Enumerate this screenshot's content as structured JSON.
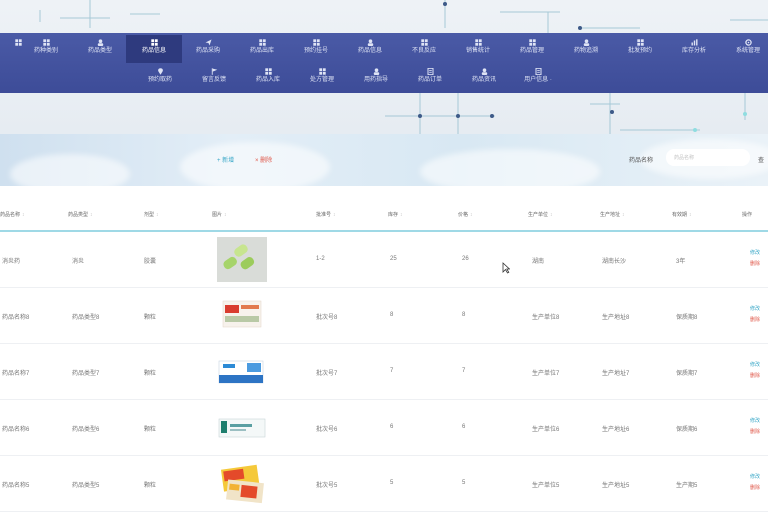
{
  "colors": {
    "nav_bg": "#3f4e9b",
    "nav_active": "#2e3a7e",
    "accent_teal": "#3aa8c8",
    "danger_red": "#e0584a",
    "header_line": "#9fd9e6"
  },
  "nav": {
    "row1": [
      {
        "label": "",
        "icon": "grid-icon"
      },
      {
        "label": "药种类别",
        "icon": "grid-icon"
      },
      {
        "label": "药品类型",
        "icon": "user-icon"
      },
      {
        "label": "药品信息",
        "icon": "grid-icon",
        "active": true
      },
      {
        "label": "药品采购",
        "icon": "send-icon"
      },
      {
        "label": "药品出库",
        "icon": "grid-icon"
      },
      {
        "label": "预约挂号",
        "icon": "grid-icon"
      },
      {
        "label": "药品信息",
        "icon": "user-icon"
      },
      {
        "label": "不良反应",
        "icon": "grid-icon"
      },
      {
        "label": "销售统计",
        "icon": "grid-icon"
      },
      {
        "label": "药品管理",
        "icon": "grid-icon"
      },
      {
        "label": "药物追溯",
        "icon": "user-icon"
      },
      {
        "label": "批发预约",
        "icon": "grid-icon"
      },
      {
        "label": "库存分析",
        "icon": "chart-icon"
      },
      {
        "label": "系统管理",
        "icon": "gear-icon"
      }
    ],
    "row2": [
      {
        "label": "预约取药",
        "icon": "pin-icon"
      },
      {
        "label": "留言反馈",
        "icon": "flag-icon"
      },
      {
        "label": "药品入库",
        "icon": "grid-icon"
      },
      {
        "label": "处方管理",
        "icon": "grid-icon"
      },
      {
        "label": "用药指导",
        "icon": "user-icon"
      },
      {
        "label": "药品订单",
        "icon": "doc-icon"
      },
      {
        "label": "药品资讯",
        "icon": "user-icon"
      },
      {
        "label": "用户信息 ·",
        "icon": "doc-icon"
      }
    ]
  },
  "toolbar": {
    "add_label": "+ 新增",
    "delete_label": "× 删除",
    "search_label": "药品名称",
    "search_placeholder": "药品名称",
    "cut_text": "查"
  },
  "table": {
    "columns": [
      "药品名称",
      "药品类型",
      "剂型",
      "图片",
      "批准号",
      "库存",
      "价格",
      "生产单位",
      "生产地址",
      "有效期",
      "操作"
    ],
    "rows": [
      {
        "name": "消炎药",
        "type": "消炎",
        "form": "胶囊",
        "img": "pack-green",
        "approval": "1-2",
        "stock": "25",
        "price": "26",
        "maker": "湖南",
        "address": "湖南长沙",
        "expiry": "3年"
      },
      {
        "name": "药品名称8",
        "type": "药品类型8",
        "form": "颗粒",
        "img": "pack-red",
        "approval": "批次号8",
        "stock": "8",
        "price": "8",
        "maker": "生产单位8",
        "address": "生产地址8",
        "expiry": "保质期8"
      },
      {
        "name": "药品名称7",
        "type": "药品类型7",
        "form": "颗粒",
        "img": "pack-blue",
        "approval": "批次号7",
        "stock": "7",
        "price": "7",
        "maker": "生产单位7",
        "address": "生产地址7",
        "expiry": "保质期7"
      },
      {
        "name": "药品名称6",
        "type": "药品类型6",
        "form": "颗粒",
        "img": "pack-teal",
        "approval": "批次号6",
        "stock": "6",
        "price": "6",
        "maker": "生产单位6",
        "address": "生产地址6",
        "expiry": "保质期6"
      },
      {
        "name": "药品名称5",
        "type": "药品类型5",
        "form": "颗粒",
        "img": "pack-yellow",
        "approval": "批次号5",
        "stock": "5",
        "price": "5",
        "maker": "生产单位5",
        "address": "生产地址5",
        "expiry": "生产期5"
      }
    ],
    "edit_label": "修改",
    "delete_label": "删除"
  }
}
